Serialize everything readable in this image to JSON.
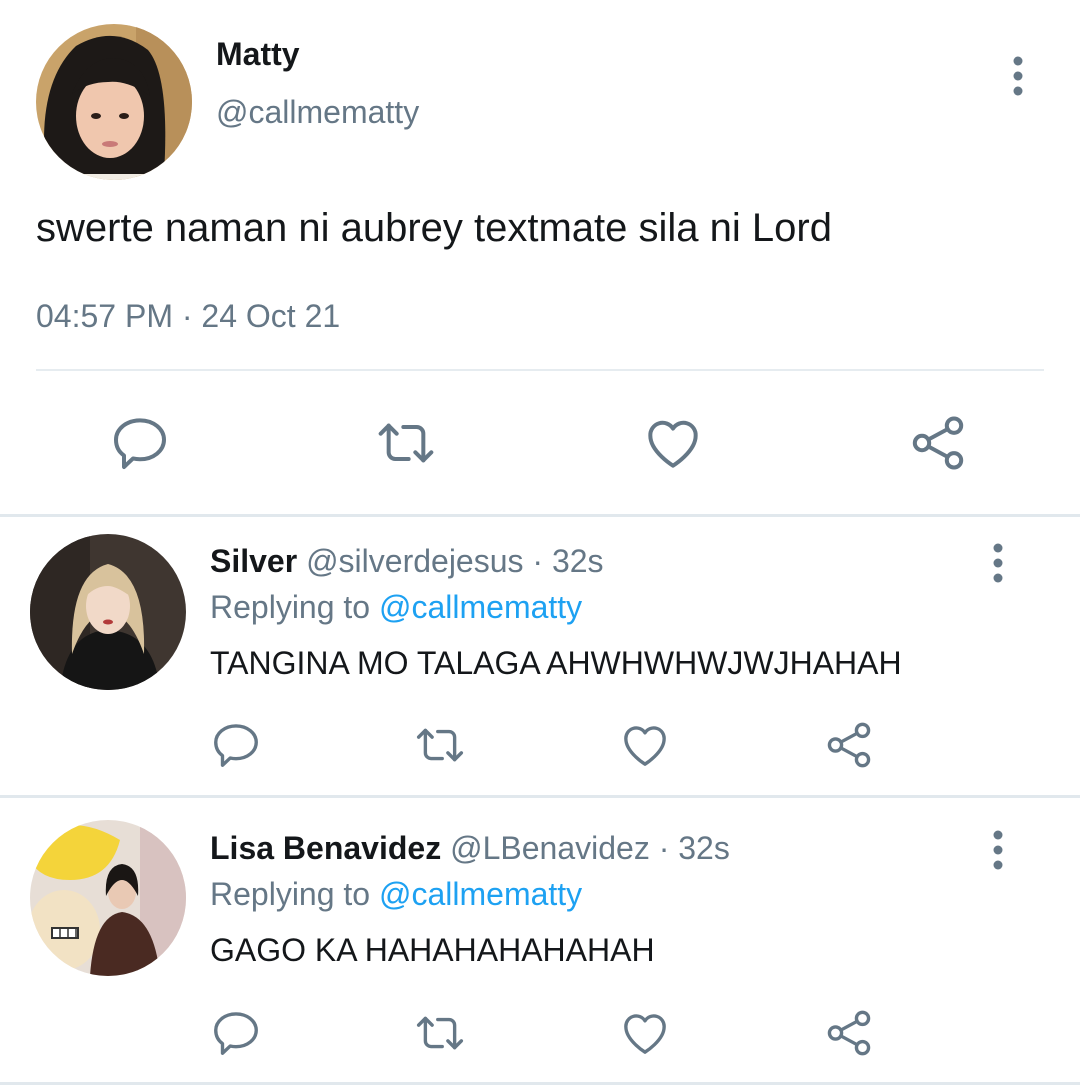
{
  "main_tweet": {
    "author_name": "Matty",
    "author_handle": "@callmematty",
    "text": "swerte naman ni aubrey textmate sila ni Lord",
    "time": "04:57 PM",
    "separator": "·",
    "date": "24 Oct 21"
  },
  "replies": [
    {
      "author_name": "Silver",
      "author_handle": "@silverdejesus",
      "separator": "·",
      "time": "32s",
      "replying_prefix": "Replying to",
      "replying_to": "@callmematty",
      "text": "TANGINA MO TALAGA AHWHWHWJWJHAHAH"
    },
    {
      "author_name": "Lisa Benavidez",
      "author_handle": "@LBenavidez",
      "separator": "·",
      "time": "32s",
      "replying_prefix": "Replying to",
      "replying_to": "@callmematty",
      "text": "GAGO KA HAHAHAHAHAHAH"
    }
  ],
  "icons": {
    "menu": "more-vertical-icon",
    "reply": "reply-bubble-icon",
    "retweet": "retweet-icon",
    "like": "heart-icon",
    "share": "share-icon"
  },
  "colors": {
    "text_primary": "#14171a",
    "text_secondary": "#657786",
    "mention": "#1da1f2",
    "divider": "#e1e8ed"
  }
}
